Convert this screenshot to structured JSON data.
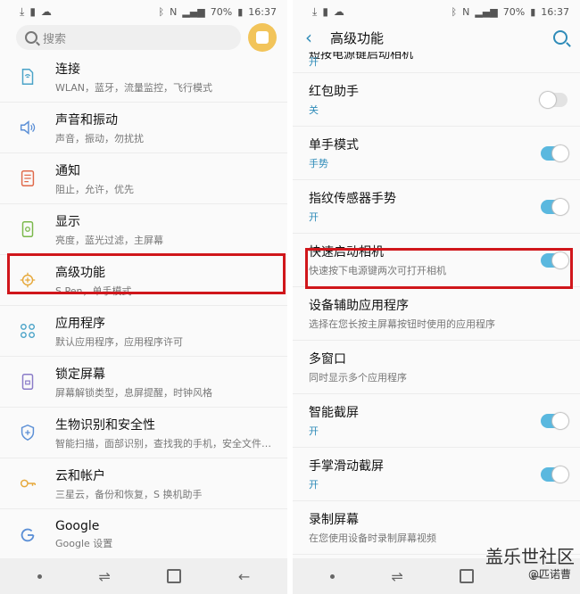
{
  "status": {
    "battery": "70%",
    "time": "16:37"
  },
  "left": {
    "search_placeholder": "搜索",
    "items": [
      {
        "title": "连接",
        "sub": "WLAN，蓝牙，流量监控，飞行模式",
        "icon": "wifi-icon"
      },
      {
        "title": "声音和振动",
        "sub": "声音，振动，勿扰扰",
        "icon": "speaker-icon"
      },
      {
        "title": "通知",
        "sub": "阻止，允许，优先",
        "icon": "notification-icon"
      },
      {
        "title": "显示",
        "sub": "亮度，蓝光过滤，主屏幕",
        "icon": "display-icon"
      },
      {
        "title": "高级功能",
        "sub": "S Pen，单手模式",
        "icon": "gear-plus-icon"
      },
      {
        "title": "应用程序",
        "sub": "默认应用程序，应用程序许可",
        "icon": "apps-icon"
      },
      {
        "title": "锁定屏幕",
        "sub": "屏幕解锁类型，息屏提醒，时钟风格",
        "icon": "lock-icon"
      },
      {
        "title": "生物识别和安全性",
        "sub": "智能扫描，面部识别，查找我的手机，安全文件…",
        "icon": "shield-icon"
      },
      {
        "title": "云和帐户",
        "sub": "三星云，备份和恢复，S 换机助手",
        "icon": "key-icon"
      },
      {
        "title": "Google",
        "sub": "Google 设置",
        "icon": "google-icon"
      }
    ]
  },
  "right": {
    "title": "高级功能",
    "partial_title": "短按电源键启动相机",
    "partial_status": "开",
    "items": [
      {
        "title": "红包助手",
        "sub": "关",
        "toggle": false,
        "blue": true
      },
      {
        "title": "单手模式",
        "sub": "手势",
        "toggle": true,
        "blue": true
      },
      {
        "title": "指纹传感器手势",
        "sub": "开",
        "toggle": true,
        "blue": true
      },
      {
        "title": "快速启动相机",
        "sub": "快速按下电源键两次可打开相机",
        "toggle": true,
        "blue": false
      },
      {
        "title": "设备辅助应用程序",
        "sub": "选择在您长按主屏幕按钮时使用的应用程序",
        "toggle": null,
        "blue": false
      },
      {
        "title": "多窗口",
        "sub": "同时显示多个应用程序",
        "toggle": null,
        "blue": false
      },
      {
        "title": "智能截屏",
        "sub": "开",
        "toggle": true,
        "blue": true
      },
      {
        "title": "手掌滑动截屏",
        "sub": "开",
        "toggle": true,
        "blue": true
      },
      {
        "title": "录制屏幕",
        "sub": "在您使用设备时录制屏幕视频",
        "toggle": null,
        "blue": false
      }
    ]
  },
  "watermark": {
    "site": "盖乐世社区",
    "user": "@匹诺曹"
  },
  "colors": {
    "accent": "#2e8bb8",
    "toggle_on": "#5ab8df",
    "highlight": "#d0161b"
  }
}
